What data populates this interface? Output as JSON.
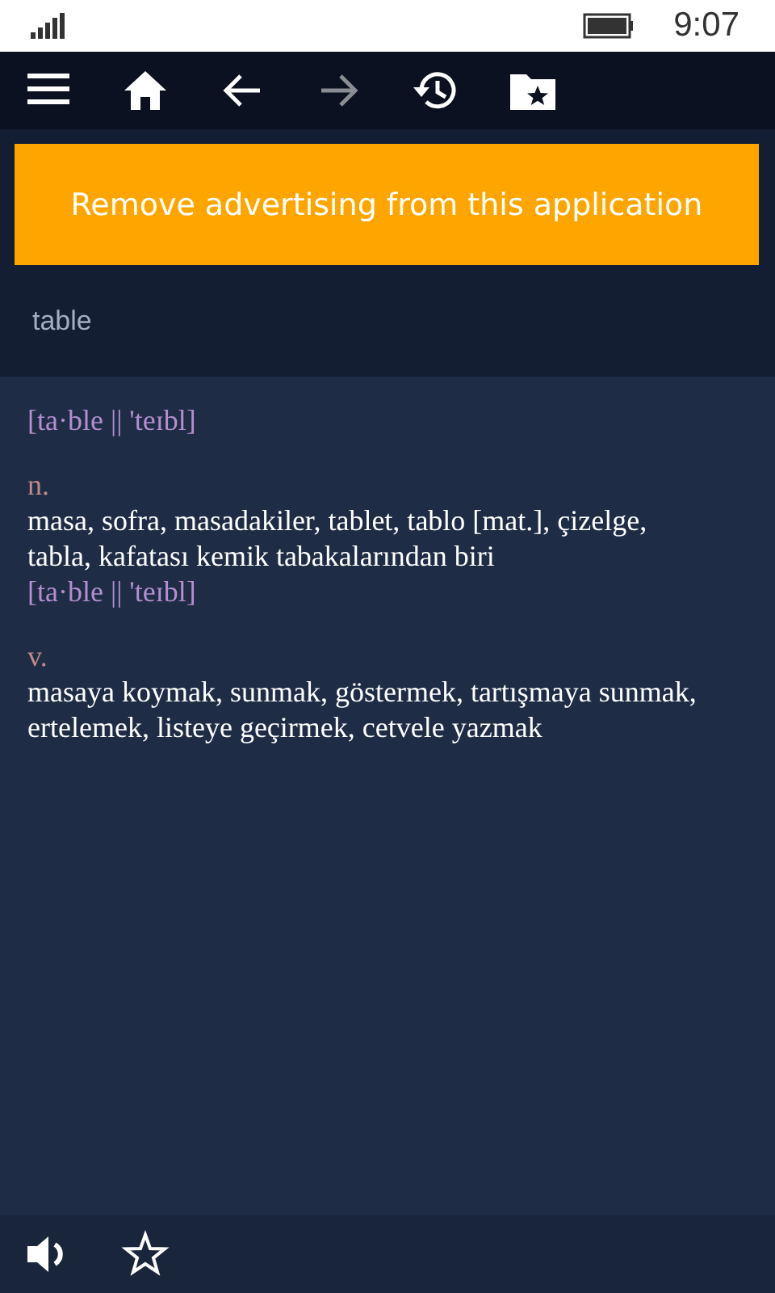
{
  "status_bar": {
    "time": "9:07"
  },
  "toolbar": [
    {
      "kind": "menu",
      "disabled": false
    },
    {
      "kind": "home",
      "disabled": false
    },
    {
      "kind": "back",
      "disabled": false
    },
    {
      "kind": "forward",
      "disabled": true
    },
    {
      "kind": "history",
      "disabled": false
    },
    {
      "kind": "favorites",
      "disabled": false
    }
  ],
  "ad_banner": {
    "label": "Remove advertising from this application"
  },
  "search": {
    "value": "table"
  },
  "entry": [
    {
      "kind": "pronunciation",
      "text": "[ta·ble || 'teɪbl]"
    },
    {
      "kind": "pos",
      "text": "n."
    },
    {
      "kind": "definition",
      "text": "masa, sofra, masadakiler, tablet, tablo [mat.], çizelge, tabla, kafatası kemik tabakalarından biri"
    },
    {
      "kind": "pronunciation",
      "text": "[ta·ble || 'teɪbl]"
    },
    {
      "kind": "pos",
      "text": "v."
    },
    {
      "kind": "definition",
      "text": "masaya koymak, sunmak, göstermek, tartışmaya sunmak, ertelemek, listeye geçirmek, cetvele yazmak"
    }
  ],
  "bottom_bar": [
    {
      "kind": "speaker"
    },
    {
      "kind": "star"
    }
  ]
}
